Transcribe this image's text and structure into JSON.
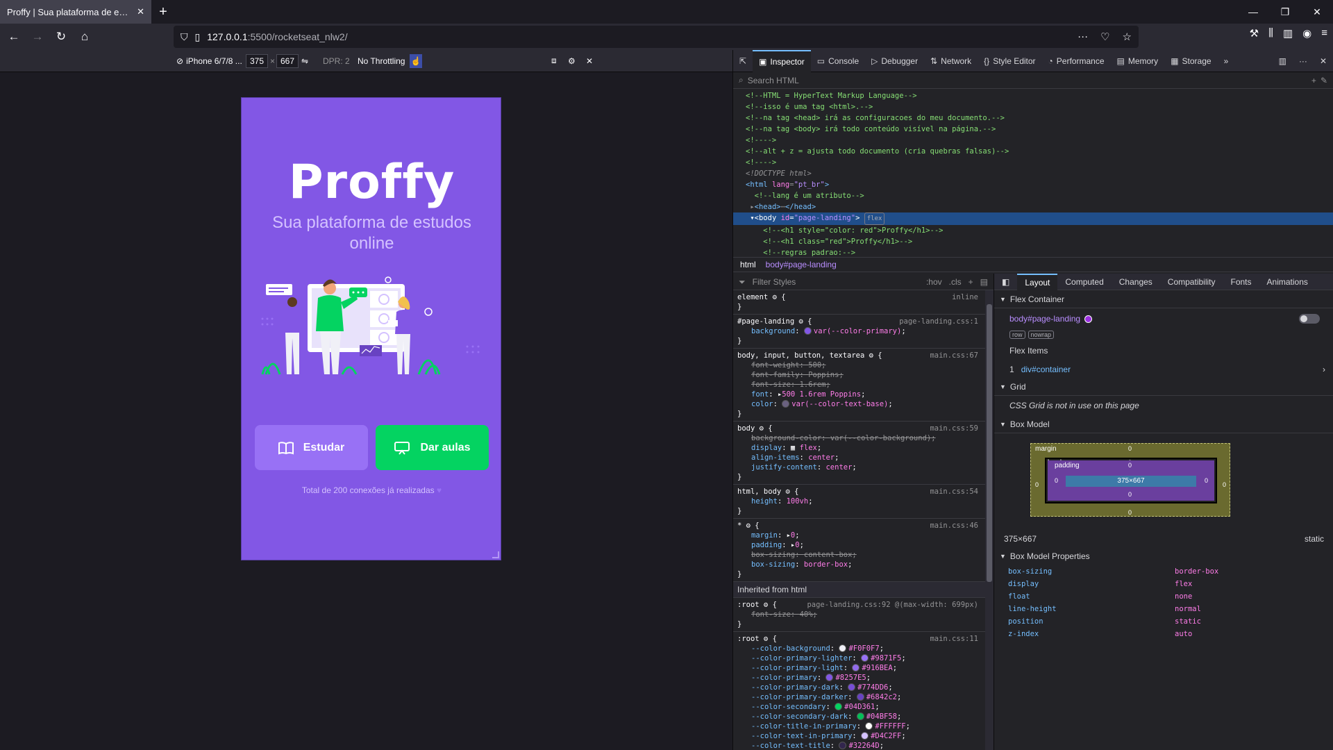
{
  "browser": {
    "tab_title": "Proffy | Sua plataforma de estudos",
    "url_host": "127.0.0.1",
    "url_path": ":5500/rocketseat_nlw2/"
  },
  "rdm": {
    "device": "iPhone 6/7/8 ...",
    "width": "375",
    "height": "667",
    "dpr": "DPR: 2",
    "throttling": "No Throttling"
  },
  "page": {
    "logo": "Proffy",
    "tagline": "Sua plataforma de estudos online",
    "study_label": "Estudar",
    "give_label": "Dar aulas",
    "total": "Total de 200 conexões já realizadas",
    "colors": {
      "primary": "#8257e5",
      "primary_lighter": "#9871f5",
      "secondary": "#04d361",
      "text_in_primary": "#d4c2ff"
    }
  },
  "devtools": {
    "tabs": [
      "Inspector",
      "Console",
      "Debugger",
      "Network",
      "Style Editor",
      "Performance",
      "Memory",
      "Storage"
    ],
    "search_placeholder": "Search HTML",
    "crumbs": [
      "html",
      "body#page-landing"
    ],
    "filter_placeholder": "Filter Styles",
    "hov": ":hov",
    "cls": ".cls",
    "layout_tabs": [
      "Layout",
      "Computed",
      "Changes",
      "Compatibility",
      "Fonts",
      "Animations"
    ],
    "flex_container_title": "Flex Container",
    "flex_container_el": "body#page-landing",
    "flex_items_title": "Flex Items",
    "flex_item": "div#container",
    "grid_title": "Grid",
    "grid_text": "CSS Grid is not in use on this page",
    "box_model_title": "Box Model",
    "box_size": "375×667",
    "box_position": "static",
    "box_content": "375×667",
    "bmp_title": "Box Model Properties",
    "inherited": "Inherited from html"
  }
}
